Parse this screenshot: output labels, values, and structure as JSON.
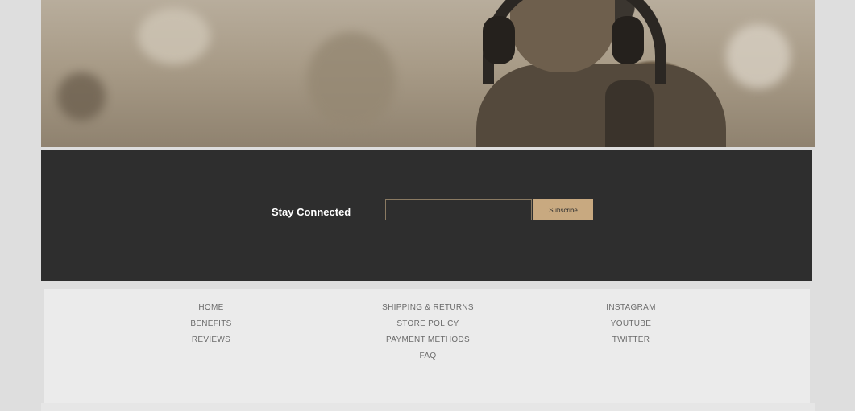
{
  "hero": {
    "image_description_icon": "photo-person-with-headphones"
  },
  "newsletter": {
    "title": "Stay Connected",
    "email_value": "",
    "email_placeholder": "",
    "button_label": "Subscribe",
    "accent_color": "#c8a980",
    "background_color": "#2e2e2e"
  },
  "footer": {
    "columns": [
      {
        "links": [
          "HOME",
          "BENEFITS",
          "REVIEWS"
        ]
      },
      {
        "links": [
          "SHIPPING & RETURNS",
          "STORE POLICY",
          "PAYMENT METHODS",
          "FAQ"
        ]
      },
      {
        "links": [
          "INSTAGRAM",
          "YOUTUBE",
          "TWITTER"
        ]
      }
    ]
  }
}
